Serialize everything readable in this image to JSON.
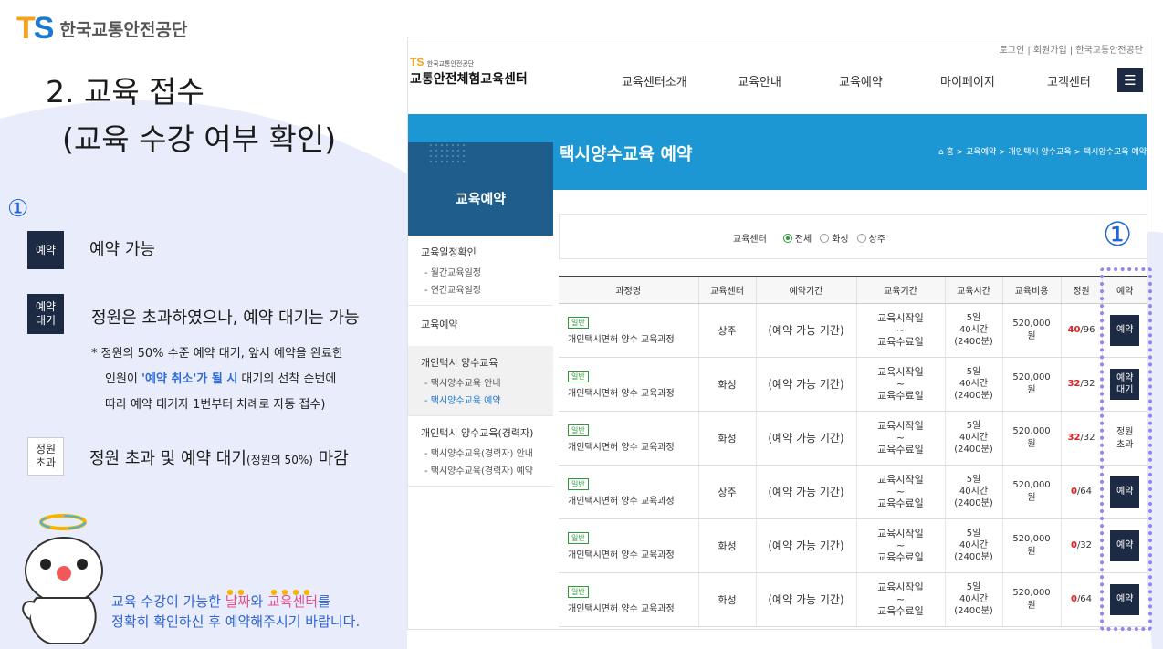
{
  "slide": {
    "logo_letters_t": "T",
    "logo_letters_s": "S",
    "org_name": "한국교통안전공단",
    "title_line1": "2. 교육 접수",
    "title_line2": "(교육 수강 여부 확인)",
    "marker": "①",
    "legend": [
      {
        "badge": "예약",
        "text": "예약 가능"
      },
      {
        "badge_line1": "예약",
        "badge_line2": "대기",
        "text": "정원은 초과하였으나, 예약 대기는 가능"
      },
      {
        "badge_line1": "정원",
        "badge_line2": "초과",
        "text_main": "정원 초과 및 예약 대기",
        "text_small": "(정원의 50%)",
        "text_end": " 마감"
      }
    ],
    "note": {
      "line1": "* 정원의 50% 수준 예약 대기, 앞서 예약을 완료한",
      "line2_pre": "인원이 ",
      "line2_hl": "'예약 취소'가 될 시",
      "line2_post": " 대기의 선착 순번에",
      "line3": "따라 예약 대기자 1번부터 차례로 자동 접수)"
    },
    "bottom": {
      "p1": "교육 수강이 가능한 ",
      "hl1": "날짜",
      "p2": "와 ",
      "hl2": "교육센터",
      "p3": "를",
      "line2": "정확히 확인하신 후 예약해주시기 바랍니다."
    }
  },
  "site": {
    "toplinks": "로그인 | 회원가입 | 한국교통안전공단",
    "logo_small": "TS",
    "logo_small_org": "한국교통안전공단",
    "logo_name": "교통안전체험교육센터",
    "gnb": [
      "교육센터소개",
      "교육안내",
      "교육예약",
      "마이페이지",
      "고객센터"
    ],
    "menu_icon": "hamburger-icon",
    "page_title": "택시양수교육 예약",
    "breadcrumb": "⌂ 홈 > 교육예약 > 개인택시 양수교육 > 택시양수교육 예약",
    "side_title": "교육예약",
    "side": [
      {
        "title": "교육일정확인",
        "subs": [
          "- 월간교육일정",
          "- 연간교육일정"
        ]
      },
      {
        "title": "교육예약",
        "subs": []
      },
      {
        "title": "개인택시 양수교육",
        "subs": [
          "- 택시양수교육 안내",
          "- 택시양수교육 예약"
        ]
      },
      {
        "title": "개인택시 양수교육(경력자)",
        "subs": [
          "- 택시양수교육(경력자) 안내",
          "- 택시양수교육(경력자) 예약"
        ]
      }
    ],
    "filter": {
      "label": "교육센터",
      "options": [
        "전체",
        "화성",
        "상주"
      ],
      "selected": "전체"
    },
    "table": {
      "headers": [
        "과정명",
        "교육센터",
        "예약기간",
        "교육기간",
        "교육시간",
        "교육비용",
        "정원",
        "예약"
      ],
      "rows": [
        {
          "tag": "일반",
          "course": "개인택시면허 양수 교육과정",
          "center": "상주",
          "period": "(예약 가능 기간)",
          "start": "교육시작일",
          "tilde": "~",
          "end": "교육수료일",
          "h1": "5일",
          "h2": "40시간",
          "h3": "(2400분)",
          "fee1": "520,000",
          "fee2": "원",
          "cap_a": "40",
          "cap_b": "/96",
          "btn1": "예약",
          "btn2": "",
          "btn_type": "dark"
        },
        {
          "tag": "일반",
          "course": "개인택시면허 양수 교육과정",
          "center": "화성",
          "period": "(예약 가능 기간)",
          "start": "교육시작일",
          "tilde": "~",
          "end": "교육수료일",
          "h1": "5일",
          "h2": "40시간",
          "h3": "(2400분)",
          "fee1": "520,000",
          "fee2": "원",
          "cap_a": "32",
          "cap_b": "/32",
          "btn1": "예약",
          "btn2": "대기",
          "btn_type": "dark"
        },
        {
          "tag": "일반",
          "course": "개인택시면허 양수 교육과정",
          "center": "화성",
          "period": "(예약 가능 기간)",
          "start": "교육시작일",
          "tilde": "~",
          "end": "교육수료일",
          "h1": "5일",
          "h2": "40시간",
          "h3": "(2400분)",
          "fee1": "520,000",
          "fee2": "원",
          "cap_a": "32",
          "cap_b": "/32",
          "btn1": "정원",
          "btn2": "초과",
          "btn_type": "text"
        },
        {
          "tag": "일반",
          "course": "개인택시면허 양수 교육과정",
          "center": "상주",
          "period": "(예약 가능 기간)",
          "start": "교육시작일",
          "tilde": "~",
          "end": "교육수료일",
          "h1": "5일",
          "h2": "40시간",
          "h3": "(2400분)",
          "fee1": "520,000",
          "fee2": "원",
          "cap_a": "0",
          "cap_b": "/64",
          "btn1": "예약",
          "btn2": "",
          "btn_type": "dark"
        },
        {
          "tag": "일반",
          "course": "개인택시면허 양수 교육과정",
          "center": "화성",
          "period": "(예약 가능 기간)",
          "start": "교육시작일",
          "tilde": "~",
          "end": "교육수료일",
          "h1": "5일",
          "h2": "40시간",
          "h3": "(2400분)",
          "fee1": "520,000",
          "fee2": "원",
          "cap_a": "0",
          "cap_b": "/32",
          "btn1": "예약",
          "btn2": "",
          "btn_type": "dark"
        },
        {
          "tag": "일반",
          "course": "개인택시면허 양수 교육과정",
          "center": "화성",
          "period": "(예약 가능 기간)",
          "start": "교육시작일",
          "tilde": "~",
          "end": "교육수료일",
          "h1": "5일",
          "h2": "40시간",
          "h3": "(2400분)",
          "fee1": "520,000",
          "fee2": "원",
          "cap_a": "0",
          "cap_b": "/64",
          "btn1": "예약",
          "btn2": "",
          "btn_type": "dark"
        }
      ]
    }
  },
  "colors": {
    "accent_blue": "#1d97d4",
    "navy": "#1c2a44",
    "red": "#e02020",
    "marker_blue": "#2166d6",
    "dotted": "#8f86f0",
    "pink": "#e94e8a"
  }
}
